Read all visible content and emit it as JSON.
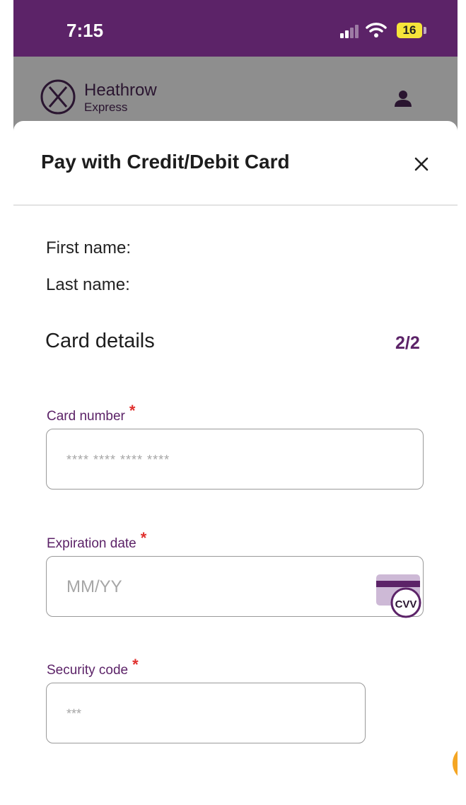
{
  "status_bar": {
    "time": "7:15",
    "battery": "16"
  },
  "app_header": {
    "brand_name": "Heathrow",
    "brand_sub": "Express"
  },
  "sheet": {
    "title": "Pay with Credit/Debit Card",
    "first_name_label": "First name:",
    "last_name_label": "Last name:",
    "section_title": "Card details",
    "step": "2/2",
    "fields": {
      "card_number": {
        "label": "Card number",
        "placeholder": "**** **** **** ****",
        "value": ""
      },
      "expiration": {
        "label": "Expiration date",
        "placeholder": "MM/YY",
        "value": ""
      },
      "security_code": {
        "label": "Security code",
        "placeholder": "***",
        "value": ""
      }
    },
    "required_marker": "*",
    "cvv_badge": "CVV"
  },
  "colors": {
    "brand_purple": "#5c2368",
    "required_red": "#e0302d",
    "overlay_grey": "#8e8e8e",
    "accent_orange": "#f5a623"
  }
}
